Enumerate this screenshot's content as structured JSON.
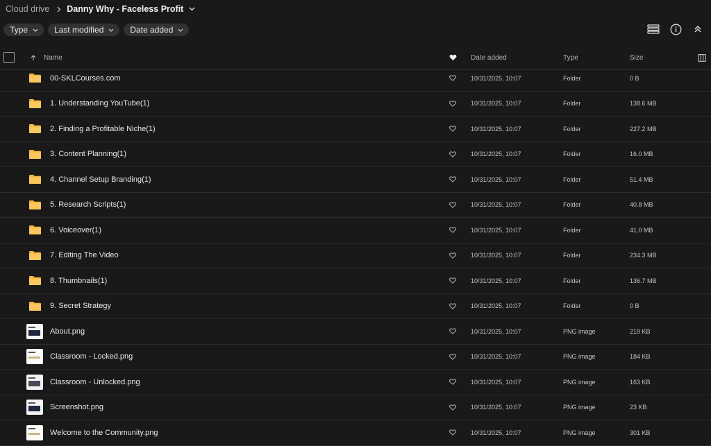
{
  "breadcrumb": {
    "root": "Cloud drive",
    "current": "Danny Why - Faceless Profit"
  },
  "filters": [
    {
      "label": "Type"
    },
    {
      "label": "Last modified"
    },
    {
      "label": "Date added"
    }
  ],
  "toolbar_icons": [
    "list-view-icon",
    "info-icon",
    "collapse-icon"
  ],
  "columns": {
    "name": "Name",
    "date": "Date added",
    "type": "Type",
    "size": "Size"
  },
  "colors": {
    "background": "#191919",
    "folder": "#f5b93b",
    "chip": "#323232"
  },
  "rows": [
    {
      "name": "00-SKLCourses.com",
      "date": "10/31/2025, 10:07",
      "type": "Folder",
      "size": "0 B",
      "icon": "folder-icon"
    },
    {
      "name": "1. Understanding YouTube(1)",
      "date": "10/31/2025, 10:07",
      "type": "Folder",
      "size": "138.6 MB",
      "icon": "folder-icon"
    },
    {
      "name": "2. Finding a Profitable Niche(1)",
      "date": "10/31/2025, 10:07",
      "type": "Folder",
      "size": "227.2 MB",
      "icon": "folder-icon"
    },
    {
      "name": "3. Content Planning(1)",
      "date": "10/31/2025, 10:07",
      "type": "Folder",
      "size": "16.0 MB",
      "icon": "folder-icon"
    },
    {
      "name": "4. Channel Setup Branding(1)",
      "date": "10/31/2025, 10:07",
      "type": "Folder",
      "size": "51.4 MB",
      "icon": "folder-icon"
    },
    {
      "name": "5. Research Scripts(1)",
      "date": "10/31/2025, 10:07",
      "type": "Folder",
      "size": "40.8 MB",
      "icon": "folder-icon"
    },
    {
      "name": "6. Voiceover(1)",
      "date": "10/31/2025, 10:07",
      "type": "Folder",
      "size": "41.0 MB",
      "icon": "folder-icon"
    },
    {
      "name": "7. Editing The Video",
      "date": "10/31/2025, 10:07",
      "type": "Folder",
      "size": "234.3 MB",
      "icon": "folder-icon"
    },
    {
      "name": "8. Thumbnails(1)",
      "date": "10/31/2025, 10:07",
      "type": "Folder",
      "size": "136.7 MB",
      "icon": "folder-icon"
    },
    {
      "name": "9. Secret Strategy",
      "date": "10/31/2025, 10:07",
      "type": "Folder",
      "size": "0 B",
      "icon": "folder-icon"
    },
    {
      "name": "About.png",
      "date": "10/31/2025, 10:07",
      "type": "PNG image",
      "size": "219 KB",
      "icon": "image-thumbnail"
    },
    {
      "name": "Classroom - Locked.png",
      "date": "10/31/2025, 10:07",
      "type": "PNG image",
      "size": "184 KB",
      "icon": "image-thumbnail"
    },
    {
      "name": "Classroom - Unlocked.png",
      "date": "10/31/2025, 10:07",
      "type": "PNG image",
      "size": "163 KB",
      "icon": "image-thumbnail"
    },
    {
      "name": "Screenshot.png",
      "date": "10/31/2025, 10:07",
      "type": "PNG image",
      "size": "23 KB",
      "icon": "image-thumbnail"
    },
    {
      "name": "Welcome to the Community.png",
      "date": "10/31/2025, 10:07",
      "type": "PNG image",
      "size": "301 KB",
      "icon": "image-thumbnail"
    }
  ]
}
